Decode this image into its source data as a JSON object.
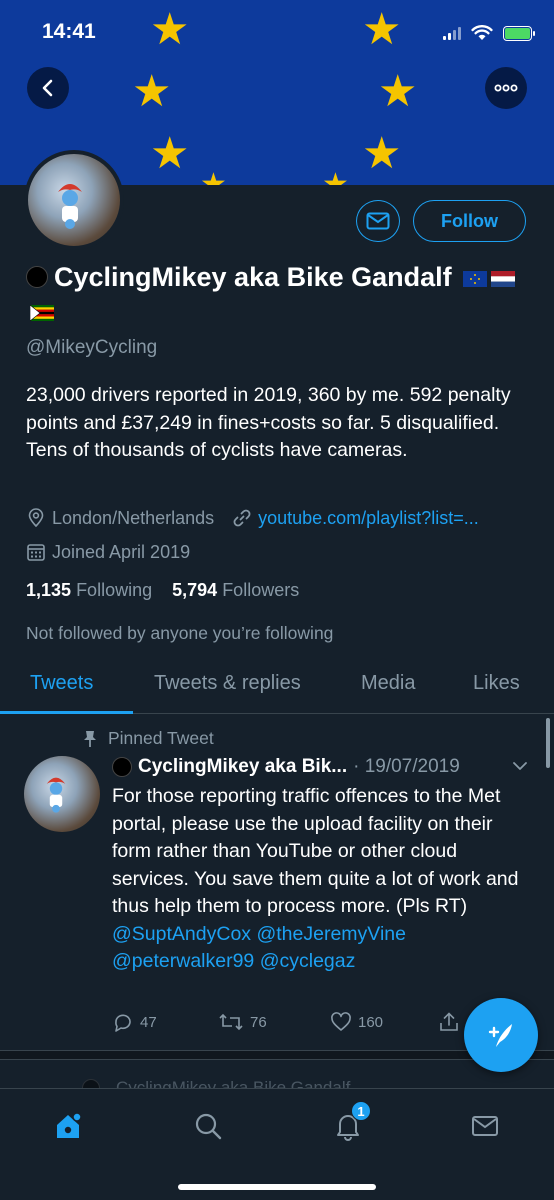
{
  "status_bar": {
    "time": "14:41"
  },
  "profile": {
    "name": "CyclingMikey aka Bike Gandalf",
    "flags": [
      "eu-flag",
      "netherlands-flag",
      "zimbabwe-flag"
    ],
    "handle": "@MikeyCycling",
    "bio": "23,000 drivers reported in 2019, 360 by me. 592 penalty points and £37,249 in fines+costs so far. 5 disqualified. Tens of thousands of cyclists have cameras.",
    "location": "London/Netherlands",
    "website": "youtube.com/playlist?list=...",
    "joined": "Joined April 2019",
    "following_count": "1,135",
    "following_label": "Following",
    "followers_count": "5,794",
    "followers_label": "Followers",
    "not_followed": "Not followed by anyone you’re following",
    "follow_label": "Follow"
  },
  "tabs": [
    {
      "label": "Tweets",
      "active": true
    },
    {
      "label": "Tweets & replies",
      "active": false
    },
    {
      "label": "Media",
      "active": false
    },
    {
      "label": "Likes",
      "active": false
    }
  ],
  "pinned_tweet": {
    "pinned_label": "Pinned Tweet",
    "author": "CyclingMikey aka Bik...",
    "date": "· 19/07/2019",
    "text": "For those reporting traffic offences to the Met portal, please use the upload facility on their form rather than YouTube or other cloud services. You save them quite a lot of work and thus help them to process more. (Pls RT) ",
    "mentions": [
      "@SuptAndyCox",
      "@theJeremyVine",
      "@peterwalker99",
      "@cyclegaz"
    ],
    "replies": "47",
    "retweets": "76",
    "likes": "160"
  },
  "next_tweet": {
    "author": "CyclingMikey aka Bike Gandalf"
  },
  "nav": {
    "notifications_badge": "1"
  },
  "colors": {
    "accent": "#1da1f2",
    "background": "#15202b",
    "muted": "#8899a6",
    "banner": "#0d3a9c",
    "star": "#f5c400"
  }
}
